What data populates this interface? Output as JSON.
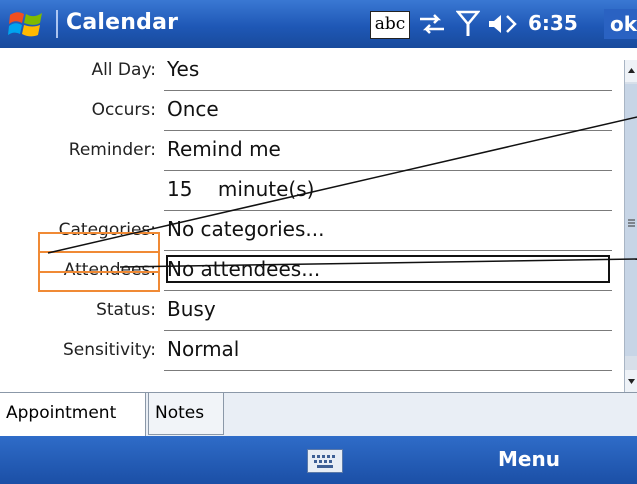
{
  "title_bar": {
    "app_title": "Calendar",
    "input_mode": "abc",
    "time": "6:35",
    "ok_label": "ok"
  },
  "fields": [
    {
      "label": "All Day:",
      "value": "Yes"
    },
    {
      "label": "Occurs:",
      "value": "Once"
    },
    {
      "label": "Reminder:",
      "value": "Remind me"
    },
    {
      "label": "",
      "value": "15    minute(s)"
    },
    {
      "label": "Categories:",
      "value": "No categories..."
    },
    {
      "label": "Attendees:",
      "value": "No attendees..."
    },
    {
      "label": "Status:",
      "value": "Busy"
    },
    {
      "label": "Sensitivity:",
      "value": "Normal"
    }
  ],
  "tabs": [
    {
      "label": "Appointment",
      "active": true
    },
    {
      "label": "Notes",
      "active": false
    }
  ],
  "bottom_bar": {
    "menu_label": "Menu"
  },
  "icons": [
    "windows-start-icon",
    "sync-icon",
    "signal-icon",
    "volume-icon",
    "keyboard-icon",
    "scroll-up-icon",
    "scroll-down-icon"
  ],
  "colors": {
    "title_bar": "#1f58b6",
    "highlight": "#f08a35",
    "bottom_bar": "#1b4fa6"
  }
}
